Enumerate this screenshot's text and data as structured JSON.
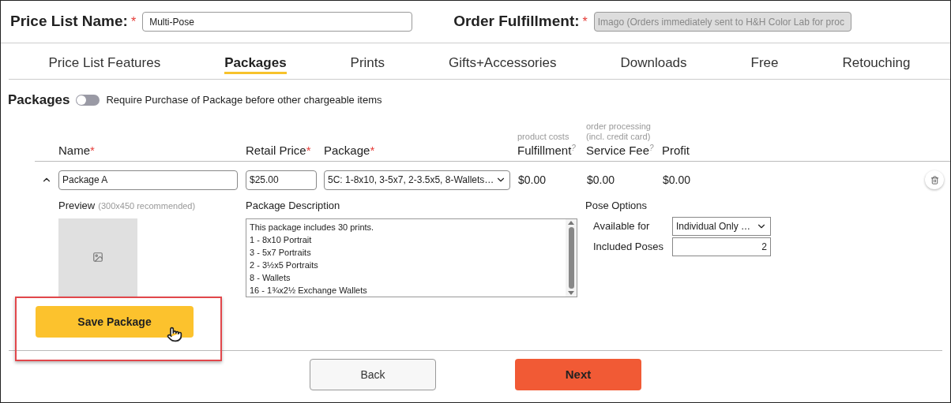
{
  "header": {
    "price_list_label": "Price List Name:",
    "required_mark": "*",
    "price_list_value": "Multi-Pose",
    "fulfillment_label": "Order Fulfillment:",
    "fulfillment_value": "Imago (Orders immediately sent to H&H Color Lab for proc"
  },
  "tabs": [
    {
      "label": "Price List Features",
      "selected": false
    },
    {
      "label": "Packages",
      "selected": true
    },
    {
      "label": "Prints",
      "selected": false
    },
    {
      "label": "Gifts+Accessories",
      "selected": false
    },
    {
      "label": "Downloads",
      "selected": false
    },
    {
      "label": "Free",
      "selected": false
    },
    {
      "label": "Retouching",
      "selected": false
    }
  ],
  "section": {
    "title": "Packages",
    "toggle_on": false,
    "toggle_label": "Require Purchase of Package before other chargeable items"
  },
  "columns": {
    "name": "Name",
    "retail_price": "Retail Price",
    "package": "Package",
    "required_mark": "*",
    "fulfillment_note": "product costs",
    "fulfillment": "Fulfillment",
    "service_note": "order processing (incl. credit card)",
    "service_fee": "Service Fee",
    "help_mark": "?",
    "profit": "Profit"
  },
  "row": {
    "expanded": true,
    "name": "Package A",
    "retail_price": "$25.00",
    "package": "5C: 1-8x10, 3-5x7, 2-3.5x5, 8-Wallets…",
    "fulfillment": "$0.00",
    "service_fee": "$0.00",
    "profit": "$0.00",
    "preview_label": "Preview",
    "preview_hint": "(300x450 recommended)",
    "description_label": "Package Description",
    "description_lines": [
      "This package includes 30 prints.",
      "1 - 8x10 Portrait",
      "3 - 5x7 Portraits",
      "2 - 3½x5 Portraits",
      "8 - Wallets",
      "16 - 1¾x2½ Exchange Wallets"
    ],
    "pose_title": "Pose Options",
    "available_label": "Available for",
    "available_value": "Individual Only …",
    "poses_label": "Included Poses",
    "poses_value": "2"
  },
  "save_button": "Save Package",
  "buttons": {
    "back": "Back",
    "next": "Next"
  }
}
